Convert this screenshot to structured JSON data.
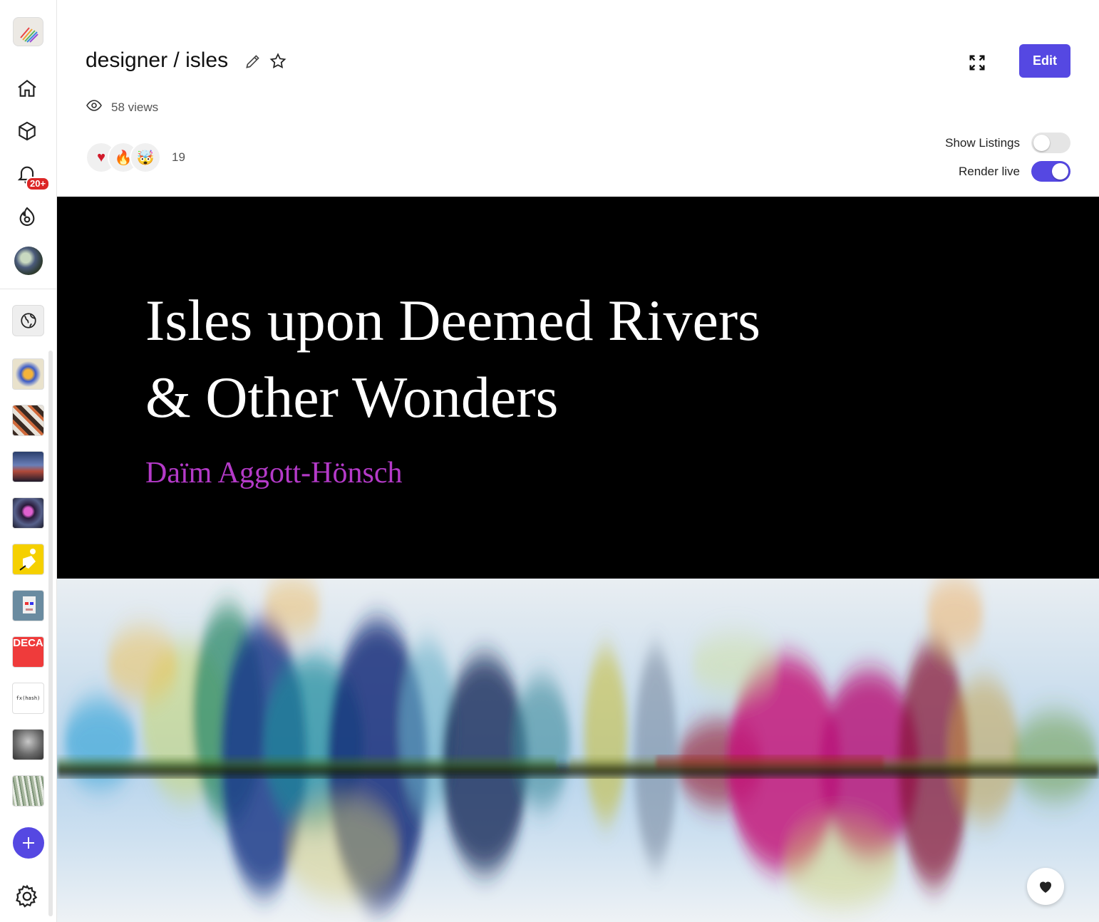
{
  "sidebar": {
    "notifications_badge": "20+",
    "thumbnails": [
      {
        "name": "cube"
      },
      {
        "name": "pattern"
      },
      {
        "name": "mountain"
      },
      {
        "name": "portrait"
      },
      {
        "name": "figure"
      },
      {
        "name": "pixel-face"
      },
      {
        "name": "deca",
        "label": "DECA"
      },
      {
        "name": "fxhash",
        "label": "fx(hash)"
      },
      {
        "name": "cloud"
      },
      {
        "name": "forest"
      }
    ]
  },
  "header": {
    "title": "designer / isles",
    "edit_label": "Edit",
    "views": "58 views",
    "reactions": [
      "♥",
      "🔥",
      "🤯"
    ],
    "reaction_count": "19",
    "show_listings_label": "Show Listings",
    "show_listings": false,
    "render_live_label": "Render live",
    "render_live": true
  },
  "artwork": {
    "title_line1": "Isles upon Deemed Rivers",
    "title_line2": "& Other Wonders",
    "author": "Daïm Aggott-Hönsch"
  },
  "colors": {
    "accent": "#5548e2",
    "badge": "#dc2626",
    "author": "#b43ac8"
  }
}
